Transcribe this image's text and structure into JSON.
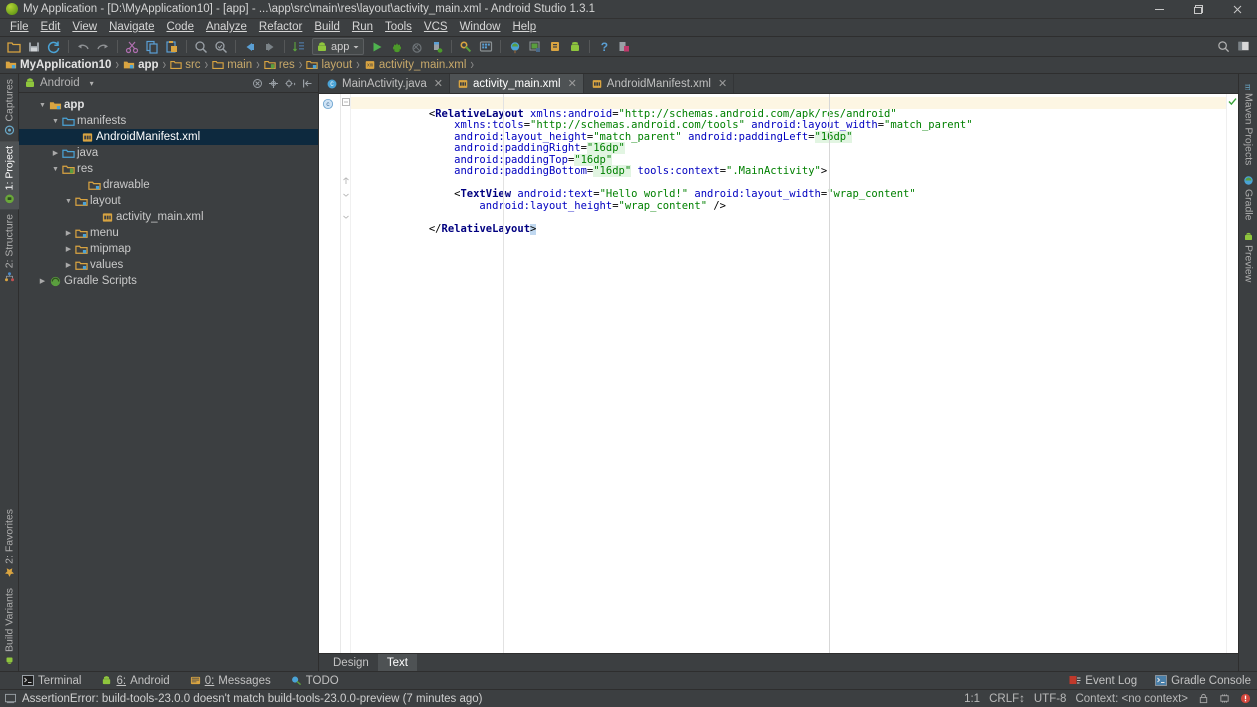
{
  "window": {
    "title": "My Application - [D:\\MyApplication10] - [app] - ...\\app\\src\\main\\res\\layout\\activity_main.xml - Android Studio 1.3.1",
    "app_icon": "android-studio-icon",
    "controls": {
      "minimize": "–",
      "maximize": "❐",
      "close": "✕"
    }
  },
  "menubar": {
    "items": [
      {
        "label": "File"
      },
      {
        "label": "Edit"
      },
      {
        "label": "View"
      },
      {
        "label": "Navigate"
      },
      {
        "label": "Code"
      },
      {
        "label": "Analyze"
      },
      {
        "label": "Refactor"
      },
      {
        "label": "Build"
      },
      {
        "label": "Run"
      },
      {
        "label": "Tools"
      },
      {
        "label": "VCS"
      },
      {
        "label": "Window"
      },
      {
        "label": "Help"
      }
    ]
  },
  "toolbar": {
    "run_config_label": "app",
    "icons": [
      "open-folder-icon",
      "save-all-icon",
      "sync-refresh-icon",
      "undo-icon",
      "redo-icon",
      "cut-icon",
      "copy-icon",
      "paste-icon",
      "find-icon",
      "replace-icon",
      "back-icon",
      "forward-icon",
      "sort-icon",
      "run-config-selector",
      "run-icon",
      "debug-icon",
      "coverage-icon",
      "attach-debugger-icon",
      "sdk-manager-icon",
      "avd-manager-icon",
      "gradle-sync-icon",
      "project-structure-icon",
      "settings-icon",
      "android-monitor-icon",
      "help-icon",
      "exit-icon"
    ],
    "right_icons": [
      "search-everywhere-icon",
      "layout-icon"
    ]
  },
  "breadcrumb": {
    "items": [
      {
        "label": "MyApplication10",
        "icon": "module-icon",
        "bold": true
      },
      {
        "label": "app",
        "icon": "module-icon",
        "bold": true
      },
      {
        "label": "src",
        "icon": "folder-icon",
        "bold": false
      },
      {
        "label": "main",
        "icon": "folder-icon",
        "bold": false
      },
      {
        "label": "res",
        "icon": "res-folder-icon",
        "bold": false
      },
      {
        "label": "layout",
        "icon": "folder-icon",
        "bold": false
      },
      {
        "label": "activity_main.xml",
        "icon": "xml-file-icon",
        "bold": false
      }
    ],
    "separator": "›"
  },
  "left_rail": {
    "top": [
      {
        "label": "Captures",
        "icon": "captures-icon",
        "active": false
      },
      {
        "label": "1: Project",
        "icon": "project-icon",
        "active": true
      },
      {
        "label": "2: Structure",
        "icon": "structure-icon",
        "active": false
      }
    ],
    "bottom": [
      {
        "label": "2: Favorites",
        "icon": "favorites-star-icon",
        "active": false
      },
      {
        "label": "Build Variants",
        "icon": "build-variants-icon",
        "active": false
      }
    ]
  },
  "right_rail": {
    "top": [
      {
        "label": "Maven Projects",
        "icon": "maven-icon"
      },
      {
        "label": "Gradle",
        "icon": "gradle-icon"
      },
      {
        "label": "Preview",
        "icon": "preview-icon"
      }
    ]
  },
  "project_panel": {
    "header_title": "Android",
    "header_icon": "android-icon",
    "header_caret": "▾",
    "tools": [
      "collapse-all-icon",
      "target-icon",
      "settings-gear-icon",
      "hide-panel-icon"
    ],
    "tree": [
      {
        "depth": 0,
        "arrow": "▼",
        "icon": "module-icon",
        "label": "app",
        "bold": true,
        "selected": false
      },
      {
        "depth": 1,
        "arrow": "▼",
        "icon": "folder-blue-icon",
        "label": "manifests",
        "bold": false,
        "selected": false
      },
      {
        "depth": 2,
        "arrow": "",
        "icon": "xml-file-icon",
        "label": "AndroidManifest.xml",
        "bold": false,
        "selected": true
      },
      {
        "depth": 1,
        "arrow": "▶",
        "icon": "folder-blue-icon",
        "label": "java",
        "bold": false,
        "selected": false
      },
      {
        "depth": 1,
        "arrow": "▼",
        "icon": "res-folder-icon",
        "label": "res",
        "bold": false,
        "selected": false
      },
      {
        "depth": 2,
        "arrow": "",
        "icon": "folder-icon",
        "label": "drawable",
        "bold": false,
        "selected": false
      },
      {
        "depth": 2,
        "arrow": "▼",
        "icon": "folder-icon",
        "label": "layout",
        "bold": false,
        "selected": false
      },
      {
        "depth": 3,
        "arrow": "",
        "icon": "xml-file-icon",
        "label": "activity_main.xml",
        "bold": false,
        "selected": false
      },
      {
        "depth": 2,
        "arrow": "▶",
        "icon": "folder-icon",
        "label": "menu",
        "bold": false,
        "selected": false
      },
      {
        "depth": 2,
        "arrow": "▶",
        "icon": "folder-icon",
        "label": "mipmap",
        "bold": false,
        "selected": false
      },
      {
        "depth": 2,
        "arrow": "▶",
        "icon": "folder-icon",
        "label": "values",
        "bold": false,
        "selected": false
      },
      {
        "depth": 0,
        "arrow": "▶",
        "icon": "gradle-icon",
        "label": "Gradle Scripts",
        "bold": false,
        "selected": false
      }
    ]
  },
  "editor": {
    "tabs": [
      {
        "label": "MainActivity.java",
        "icon": "java-class-icon",
        "active": false,
        "close": "✕"
      },
      {
        "label": "activity_main.xml",
        "icon": "xml-file-icon",
        "active": true,
        "close": "✕"
      },
      {
        "label": "AndroidManifest.xml",
        "icon": "xml-file-icon",
        "active": false,
        "close": "✕"
      }
    ],
    "design_tabs": [
      {
        "label": "Design",
        "active": false
      },
      {
        "label": "Text",
        "active": true
      }
    ],
    "code_lines": [
      [
        {
          "t": "<",
          "c": "punc"
        },
        {
          "t": "RelativeLayout",
          "c": "tagname"
        },
        {
          "t": " ",
          "c": "punc"
        },
        {
          "t": "xmlns:android",
          "c": "attr"
        },
        {
          "t": "=",
          "c": "punc"
        },
        {
          "t": "\"http://schemas.android.com/apk/res/android\"",
          "c": "str"
        }
      ],
      [
        {
          "t": "    xmlns:tools",
          "c": "attr"
        },
        {
          "t": "=",
          "c": "punc"
        },
        {
          "t": "\"http://schemas.android.com/tools\"",
          "c": "str"
        },
        {
          "t": " ",
          "c": "punc"
        },
        {
          "t": "android:layout_width",
          "c": "attr"
        },
        {
          "t": "=",
          "c": "punc"
        },
        {
          "t": "\"match_parent\"",
          "c": "str"
        }
      ],
      [
        {
          "t": "    android:layout_height",
          "c": "attr"
        },
        {
          "t": "=",
          "c": "punc"
        },
        {
          "t": "\"match_parent\"",
          "c": "str"
        },
        {
          "t": " ",
          "c": "punc"
        },
        {
          "t": "android:paddingLeft",
          "c": "attr"
        },
        {
          "t": "=",
          "c": "punc"
        },
        {
          "t": "\"16dp\"",
          "c": "strhl"
        }
      ],
      [
        {
          "t": "    android:paddingRight",
          "c": "attr"
        },
        {
          "t": "=",
          "c": "punc"
        },
        {
          "t": "\"16dp\"",
          "c": "strhl"
        }
      ],
      [
        {
          "t": "    android:paddingTop",
          "c": "attr"
        },
        {
          "t": "=",
          "c": "punc"
        },
        {
          "t": "\"16dp\"",
          "c": "strhl"
        }
      ],
      [
        {
          "t": "    android:paddingBottom",
          "c": "attr"
        },
        {
          "t": "=",
          "c": "punc"
        },
        {
          "t": "\"16dp\"",
          "c": "strhl"
        },
        {
          "t": " ",
          "c": "punc"
        },
        {
          "t": "tools:context",
          "c": "attr"
        },
        {
          "t": "=",
          "c": "punc"
        },
        {
          "t": "\".MainActivity\"",
          "c": "str"
        },
        {
          "t": ">",
          "c": "punc"
        }
      ],
      [],
      [
        {
          "t": "    <",
          "c": "punc"
        },
        {
          "t": "TextView",
          "c": "tagname"
        },
        {
          "t": " ",
          "c": "punc"
        },
        {
          "t": "android:text",
          "c": "attr"
        },
        {
          "t": "=",
          "c": "punc"
        },
        {
          "t": "\"Hello world!\"",
          "c": "str"
        },
        {
          "t": " ",
          "c": "punc"
        },
        {
          "t": "android:layout_width",
          "c": "attr"
        },
        {
          "t": "=",
          "c": "punc"
        },
        {
          "t": "\"wrap_content\"",
          "c": "str"
        }
      ],
      [
        {
          "t": "        android:layout_height",
          "c": "attr"
        },
        {
          "t": "=",
          "c": "punc"
        },
        {
          "t": "\"wrap_content\"",
          "c": "str"
        },
        {
          "t": " />",
          "c": "punc"
        }
      ],
      [],
      [
        {
          "t": "</",
          "c": "punc"
        },
        {
          "t": "RelativeLayout",
          "c": "tagname"
        },
        {
          "t": ">",
          "c": "punc"
        }
      ]
    ]
  },
  "bottom_tools": {
    "items": [
      {
        "label": "Terminal",
        "icon": "terminal-icon",
        "mnemonic": ""
      },
      {
        "label": "Android",
        "icon": "android-icon",
        "mnemonic": "6:"
      },
      {
        "label": "Messages",
        "icon": "messages-icon",
        "mnemonic": "0:"
      },
      {
        "label": "TODO",
        "icon": "todo-icon",
        "mnemonic": ""
      }
    ],
    "right": [
      {
        "label": "Event Log",
        "icon": "event-log-icon"
      },
      {
        "label": "Gradle Console",
        "icon": "gradle-console-icon"
      }
    ]
  },
  "statusbar": {
    "icon": "info-icon",
    "message": "AssertionError: build-tools-23.0.0 doesn't match build-tools-23.0.0-preview (7 minutes ago)",
    "caret_position": "1:1",
    "line_separator": "CRLF↕",
    "encoding": "UTF-8",
    "context": "Context: <no context>",
    "right_icons": [
      "lock-icon",
      "memory-icon",
      "error-badge-icon"
    ]
  },
  "colors": {
    "ui_bg": "#3c3f41",
    "editor_bg": "#ffffff",
    "selection": "#0d293e",
    "accent_orange": "#c8a96a",
    "tag": "#000080",
    "attribute": "#0000c0",
    "string": "#008000",
    "highlight_line": "#fdf6e3"
  }
}
